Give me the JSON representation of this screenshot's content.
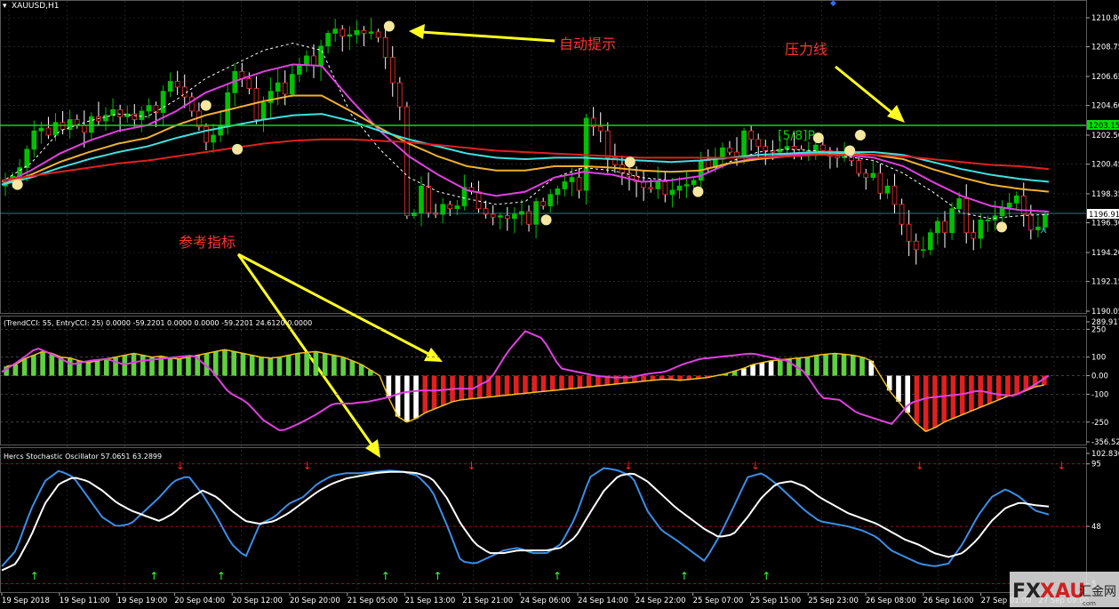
{
  "symbol_label": "XAUUSD,H1",
  "colors": {
    "bull": "#00c000",
    "bear": "#ffffff",
    "grid": "#3a3a3a",
    "ma_white": "#ffffff",
    "ma_magenta": "#e040e0",
    "ma_orange": "#f0b030",
    "ma_cyan": "#40e0e0",
    "ma_red": "#e02020",
    "pressure": "#00e000",
    "dot": "#f5e6a0",
    "arrow": "#ffff20",
    "anno": "#ff3333",
    "cci_green": "#60d040",
    "cci_red": "#e02020",
    "cci_white": "#ffffff",
    "cci_yellow": "#f0c020",
    "stoch_blue": "#3a8ee8",
    "stoch_white": "#ffffff",
    "buy_arrow": "#40ff40",
    "sell_arrow": "#ff2020"
  },
  "annotations": {
    "auto_hint": "自动提示",
    "pressure_line": "压力线",
    "reference_indicator": "参考指标",
    "pivot_label": "[5/8]P"
  },
  "price_axis": {
    "ticks": [
      "1210.80",
      "1208.75",
      "1206.65",
      "1204.60",
      "1202.50",
      "1200.45",
      "1198.35",
      "1196.30",
      "1194.20",
      "1192.15",
      "1190.05"
    ],
    "current_price": "1196.91",
    "pressure_price": "1203.15"
  },
  "cci_panel": {
    "label": "(TrendCCI: 55, EntryCCI: 25) 0.0000 -59.2201 0.0000 0.0000 -59.2201 24.6120 0.0000",
    "ticks": [
      "289.917",
      "250",
      "100",
      "0.00",
      "-100",
      "-250",
      "-356.523"
    ]
  },
  "stoch_panel": {
    "label": "Hercs Stochastic Oscillator 57.0651 63.2899",
    "ticks": [
      "102.836",
      "95",
      "48",
      "5"
    ]
  },
  "time_axis": [
    "19 Sep 2018",
    "19 Sep 11:00",
    "19 Sep 19:00",
    "20 Sep 04:00",
    "20 Sep 12:00",
    "20 Sep 20:00",
    "21 Sep 05:00",
    "21 Sep 13:00",
    "21 Sep 21:00",
    "24 Sep 06:00",
    "24 Sep 14:00",
    "24 Sep 22:00",
    "25 Sep 07:00",
    "25 Sep 15:00",
    "25 Sep 23:00",
    "26 Sep 08:00",
    "26 Sep 16:00",
    "27 Sep 01:00",
    "27 Sep 09:00"
  ],
  "watermark": {
    "fx": "FX",
    "xau": "XAU",
    "cn": "汇金网",
    "sub": "com"
  },
  "chart_data": [
    {
      "type": "candlestick",
      "title": "XAUUSD,H1",
      "ylim": [
        1190.05,
        1211.5
      ],
      "close_path": [
        1199.2,
        1199.6,
        1200.2,
        1201.5,
        1202.8,
        1203.0,
        1202.5,
        1203.4,
        1202.9,
        1203.6,
        1203.2,
        1202.7,
        1203.8,
        1203.5,
        1203.9,
        1204.3,
        1203.8,
        1204.0,
        1203.6,
        1204.2,
        1204.6,
        1204.1,
        1205.6,
        1206.3,
        1205.9,
        1205.2,
        1204.2,
        1203.1,
        1202.0,
        1202.5,
        1203.2,
        1205.5,
        1207.0,
        1206.5,
        1205.8,
        1203.6,
        1204.8,
        1205.6,
        1206.2,
        1205.4,
        1206.8,
        1207.5,
        1208.1,
        1207.4,
        1208.8,
        1209.7,
        1210.0,
        1209.5,
        1209.6,
        1209.9,
        1209.7,
        1209.8,
        1209.4,
        1208.0,
        1206.2,
        1204.5,
        1196.8,
        1197.0,
        1198.9,
        1197.0,
        1196.9,
        1197.6,
        1197.3,
        1197.5,
        1198.8,
        1198.5,
        1197.3,
        1196.9,
        1196.7,
        1196.8,
        1196.6,
        1196.9,
        1197.1,
        1196.2,
        1197.8,
        1197.5,
        1198.3,
        1198.7,
        1199.2,
        1199.5,
        1198.6,
        1203.7,
        1203.1,
        1202.8,
        1200.9,
        1200.4,
        1199.8,
        1199.6,
        1199.2,
        1198.8,
        1198.7,
        1199.2,
        1198.3,
        1198.6,
        1198.9,
        1199.0,
        1199.3,
        1200.7,
        1200.2,
        1200.8,
        1201.6,
        1201.3,
        1201.0,
        1202.8,
        1202.2,
        1201.7,
        1201.4,
        1201.3,
        1201.5,
        1201.7,
        1201.5,
        1201.1,
        1201.4,
        1201.8,
        1201.4,
        1201.0,
        1200.9,
        1201.0,
        1200.7,
        1199.8,
        1199.5,
        1199.8,
        1198.4,
        1198.9,
        1197.6,
        1196.2,
        1195.0,
        1194.4,
        1194.4,
        1195.6,
        1196.4,
        1195.6,
        1197.3,
        1198.0,
        1195.6,
        1195.2,
        1196.5,
        1196.5,
        1196.8,
        1197.4,
        1197.7,
        1198.2,
        1196.9,
        1195.8,
        1196.0,
        1196.9
      ],
      "series": [
        {
          "name": "",
          "color": "#ffffff",
          "style": "dashed",
          "values": [
            1199.2,
            1200.5,
            1202.8,
            1203.5,
            1204.0,
            1203.8,
            1205.0,
            1206.5,
            1207.5,
            1208.5,
            1209.0,
            1208.5,
            1204.0,
            1201.5,
            1199.5,
            1198.5,
            1198.0,
            1197.6,
            1197.8,
            1199.5,
            1200.2,
            1200.0,
            1199.5,
            1199.3,
            1199.6,
            1200.6,
            1201.3,
            1201.5,
            1201.4,
            1201.0,
            1200.7,
            1199.8,
            1198.5,
            1197.0,
            1196.6,
            1196.8,
            1196.9
          ]
        },
        {
          "name": "",
          "color": "#e040e0",
          "style": "solid",
          "values": [
            1199.0,
            1200.0,
            1201.2,
            1202.1,
            1202.8,
            1203.2,
            1204.2,
            1205.5,
            1206.3,
            1207.0,
            1207.5,
            1207.4,
            1205.0,
            1202.8,
            1201.0,
            1199.7,
            1198.6,
            1198.2,
            1198.5,
            1199.5,
            1199.9,
            1199.7,
            1199.2,
            1199.3,
            1199.6,
            1200.5,
            1200.9,
            1201.1,
            1201.2,
            1201.1,
            1200.9,
            1200.3,
            1199.2,
            1198.2,
            1197.5,
            1197.2,
            1197.1
          ]
        },
        {
          "name": "",
          "color": "#f0b030",
          "style": "solid",
          "values": [
            1199.0,
            1199.7,
            1200.6,
            1201.3,
            1201.9,
            1202.3,
            1203.2,
            1203.9,
            1204.4,
            1204.9,
            1205.3,
            1205.3,
            1204.2,
            1203.0,
            1201.9,
            1201.0,
            1200.3,
            1200.0,
            1200.0,
            1200.3,
            1200.3,
            1200.2,
            1200.0,
            1199.9,
            1200.0,
            1200.5,
            1200.8,
            1201.0,
            1201.1,
            1201.2,
            1201.1,
            1200.8,
            1200.1,
            1199.5,
            1199.0,
            1198.7,
            1198.5
          ]
        },
        {
          "name": "",
          "color": "#40e0e0",
          "style": "solid",
          "values": [
            1199.0,
            1199.5,
            1200.2,
            1200.8,
            1201.3,
            1201.7,
            1202.3,
            1202.8,
            1203.2,
            1203.6,
            1203.9,
            1204.0,
            1203.5,
            1202.8,
            1202.2,
            1201.7,
            1201.2,
            1200.9,
            1200.8,
            1200.9,
            1200.9,
            1200.8,
            1200.7,
            1200.6,
            1200.7,
            1200.9,
            1201.1,
            1201.2,
            1201.3,
            1201.3,
            1201.3,
            1201.1,
            1200.6,
            1200.1,
            1199.7,
            1199.4,
            1199.2
          ]
        },
        {
          "name": "",
          "color": "#e02020",
          "style": "solid",
          "values": [
            1199.3,
            1199.6,
            1199.9,
            1200.2,
            1200.5,
            1200.7,
            1201.0,
            1201.3,
            1201.6,
            1201.9,
            1202.1,
            1202.2,
            1202.2,
            1202.1,
            1202.0,
            1201.8,
            1201.6,
            1201.4,
            1201.3,
            1201.2,
            1201.1,
            1201.0,
            1200.9,
            1200.9,
            1200.9,
            1200.9,
            1200.9,
            1201.0,
            1201.1,
            1201.1,
            1201.1,
            1201.0,
            1200.8,
            1200.6,
            1200.4,
            1200.3,
            1200.1
          ]
        }
      ]
    },
    {
      "type": "bar",
      "title": "(TrendCCI: 55, EntryCCI: 25) 0.0000 -59.2201 0.0000 0.0000 -59.2201 24.6120 0.0000",
      "ylim": [
        -356.523,
        289.917
      ],
      "histogram": [
        50,
        60,
        90,
        110,
        130,
        120,
        100,
        95,
        80,
        70,
        80,
        90,
        100,
        110,
        120,
        110,
        100,
        105,
        95,
        90,
        100,
        110,
        120,
        130,
        140,
        130,
        120,
        110,
        100,
        95,
        100,
        110,
        120,
        125,
        130,
        120,
        110,
        100,
        80,
        60,
        30,
        0,
        -120,
        -220,
        -250,
        -230,
        -200,
        -180,
        -160,
        -140,
        -130,
        -125,
        -120,
        -115,
        -110,
        -105,
        -100,
        -95,
        -90,
        -85,
        -80,
        -75,
        -70,
        -65,
        -60,
        -55,
        -50,
        -45,
        -40,
        -35,
        -30,
        -25,
        -20,
        -20,
        -25,
        -20,
        -15,
        -10,
        0,
        10,
        25,
        40,
        60,
        70,
        80,
        85,
        90,
        95,
        100,
        110,
        115,
        120,
        115,
        110,
        100,
        80,
        0,
        -80,
        -140,
        -200,
        -260,
        -300,
        -280,
        -250,
        -230,
        -210,
        -190,
        -170,
        -150,
        -130,
        -110,
        -100,
        -80,
        -60,
        -50
      ],
      "trend_line": [
        20,
        80,
        150,
        110,
        60,
        80,
        90,
        60,
        80,
        90,
        100,
        110,
        30,
        -90,
        -140,
        -240,
        -300,
        -260,
        -210,
        -150,
        -150,
        -140,
        -120,
        -90,
        -80,
        -80,
        -70,
        -70,
        -20,
        130,
        240,
        200,
        40,
        20,
        0,
        -10,
        -10,
        10,
        20,
        60,
        90,
        100,
        110,
        120,
        100,
        80,
        20,
        -120,
        -130,
        -200,
        -230,
        -260,
        -150,
        -120,
        -110,
        -100,
        -80,
        -100,
        -110,
        -60,
        0
      ],
      "entry_line": [
        -10,
        40,
        110,
        90,
        70,
        80,
        85,
        70,
        75,
        85,
        90,
        95,
        60,
        -30,
        -160,
        -250,
        -270,
        -240,
        -200,
        -160,
        -140,
        -130,
        -110,
        -100,
        -90,
        -80,
        -70,
        -60,
        -40,
        20,
        40,
        20,
        0,
        -10,
        -10,
        0,
        10,
        30,
        60,
        80,
        90,
        100,
        95,
        85,
        60,
        10,
        -60,
        -150,
        -200,
        -240,
        -250,
        -220,
        -170,
        -140,
        -120,
        -100,
        -90,
        -80,
        -70,
        -40,
        -20
      ]
    },
    {
      "type": "line",
      "title": "Hercs Stochastic Oscillator 57.0651 63.2899",
      "ylim": [
        0,
        102.836
      ],
      "series": [
        {
          "name": "",
          "color": "#3a8ee8",
          "values": [
            18,
            30,
            60,
            82,
            90,
            85,
            70,
            55,
            48,
            50,
            60,
            70,
            82,
            86,
            72,
            55,
            35,
            25,
            50,
            55,
            65,
            70,
            80,
            86,
            88,
            88,
            89,
            90,
            89,
            86,
            75,
            50,
            22,
            20,
            25,
            30,
            32,
            28,
            28,
            35,
            55,
            85,
            92,
            90,
            85,
            60,
            45,
            38,
            30,
            22,
            40,
            62,
            85,
            88,
            80,
            70,
            60,
            52,
            50,
            48,
            45,
            40,
            30,
            25,
            20,
            18,
            20,
            35,
            55,
            70,
            76,
            70,
            60,
            57
          ]
        },
        {
          "name": "",
          "color": "#ffffff",
          "values": [
            15,
            20,
            40,
            65,
            80,
            85,
            82,
            75,
            66,
            60,
            56,
            52,
            58,
            68,
            75,
            70,
            60,
            52,
            50,
            52,
            58,
            66,
            74,
            80,
            84,
            86,
            88,
            89,
            89,
            88,
            84,
            70,
            50,
            35,
            28,
            28,
            30,
            30,
            30,
            32,
            40,
            58,
            75,
            86,
            88,
            82,
            72,
            62,
            54,
            46,
            40,
            42,
            55,
            70,
            80,
            82,
            78,
            70,
            64,
            58,
            54,
            50,
            44,
            38,
            34,
            28,
            25,
            28,
            38,
            52,
            62,
            66,
            64,
            63
          ]
        }
      ],
      "buy_signals": [
        2,
        18,
        27,
        49,
        56,
        72,
        89,
        100
      ],
      "sell_signals": [
        12,
        29,
        51,
        72,
        89,
        111,
        130,
        144
      ]
    }
  ]
}
